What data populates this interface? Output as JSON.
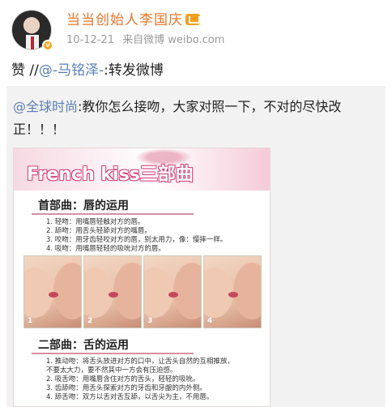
{
  "header": {
    "username": "当当创始人李国庆",
    "date": "10-12-21",
    "source": "来自微博 weibo.com"
  },
  "repost": {
    "prefix": "赞 //",
    "mention": "@-马铭泽-",
    "suffix": ":转发微博"
  },
  "original": {
    "mention": "@全球时尚",
    "text": ":教你怎么接吻，大家对照一下，不对的尽快改正！！！"
  },
  "image": {
    "banner_title": "French kiss三部曲",
    "section1": {
      "title": "首部曲：唇的运用",
      "items": [
        "1. 轻吻：用嘴唇轻触对方的唇。",
        "2. 舔吻：用舌头轻舔对方的嘴唇。",
        "3. 咬吻：用牙齿轻咬对方的唇，别太用力，像：慢摔一样。",
        "4. 吸吻：用嘴唇轻轻的吸吮对方的唇。"
      ]
    },
    "photo_numbers": [
      "1",
      "2",
      "3",
      "4"
    ],
    "section2": {
      "title": "二部曲：舌的运用",
      "items": [
        "1. 推动吻：将舌头放进对方的口中，让舌头自然的互相推放，",
        "   不要太大力，要不然其中一方会有压迫感。",
        "2. 吸舌吻：用嘴唇含住对方的舌头，轻轻的吸吮。",
        "3. 齿舔吻：用舌头探索对方的牙齿和牙龈的内外侧。",
        "4. 舔舌吻：双方以舌对舌互舔，以舌尖为主，不用唇。"
      ]
    }
  },
  "colors": {
    "username": "#e8762d",
    "mention": "#5a7fb5",
    "meta": "#9a9a9a",
    "quote_bg": "#f2f2f2"
  }
}
